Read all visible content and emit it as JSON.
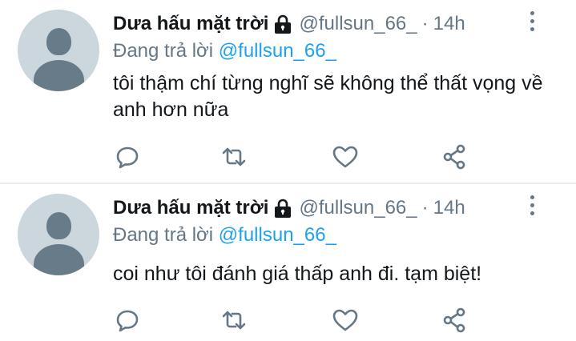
{
  "tweets": [
    {
      "name": "Dưa hấu mặt trời",
      "handle": "@fullsun_66_",
      "dot": "·",
      "time": "14h",
      "replying_prefix": "Đang trả lời",
      "replying_to": "@fullsun_66_",
      "text": "tôi thậm chí từng nghĩ sẽ không thể thất vọng về anh hơn nữa"
    },
    {
      "name": "Dưa hấu mặt trời",
      "handle": "@fullsun_66_",
      "dot": "·",
      "time": "14h",
      "replying_prefix": "Đang trả lời",
      "replying_to": "@fullsun_66_",
      "text": "coi như tôi đánh giá thấp anh đi. tạm biệt!"
    }
  ],
  "icons": {
    "protected": "lock-icon",
    "more": "more-vertical-icon",
    "reply": "reply-icon",
    "retweet": "retweet-icon",
    "like": "heart-icon",
    "share": "share-icon"
  },
  "colors": {
    "text": "#14171a",
    "secondary": "#657786",
    "link": "#1da1f2",
    "avatar_bg": "#ccd6dd",
    "avatar_fg": "#687b89",
    "divider": "#e6ecf0"
  }
}
